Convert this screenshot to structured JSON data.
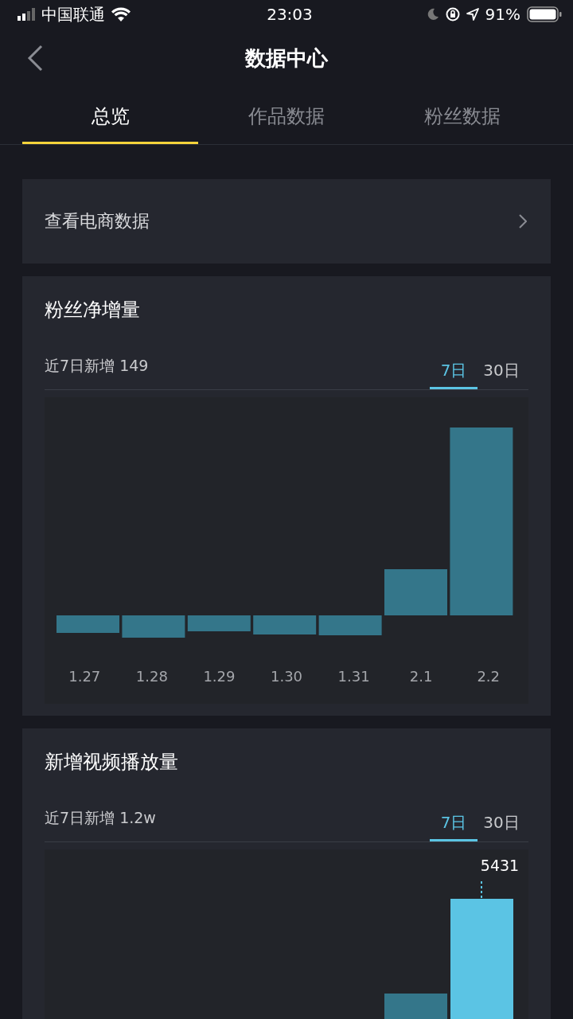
{
  "status_bar": {
    "carrier": "中国联通",
    "time": "23:03",
    "battery": "91%"
  },
  "header": {
    "title": "数据中心"
  },
  "tabs": [
    {
      "label": "总览",
      "selected": true
    },
    {
      "label": "作品数据",
      "selected": false
    },
    {
      "label": "粉丝数据",
      "selected": false
    }
  ],
  "shop_link": {
    "label": "查看电商数据"
  },
  "cards": [
    {
      "kind": "net",
      "title": "粉丝净增量",
      "summary": "近7日新增 149",
      "ranges": [
        {
          "label": "7日",
          "selected": true
        },
        {
          "label": "30日",
          "selected": false
        }
      ],
      "x_labels": [
        "1.27",
        "1.28",
        "1.29",
        "1.30",
        "1.31",
        "2.1",
        "2.2"
      ]
    },
    {
      "kind": "plays",
      "title": "新增视频播放量",
      "summary": "近7日新增 1.2w",
      "ranges": [
        {
          "label": "7日",
          "selected": true
        },
        {
          "label": "30日",
          "selected": false
        }
      ],
      "value_label": "5431"
    }
  ]
}
